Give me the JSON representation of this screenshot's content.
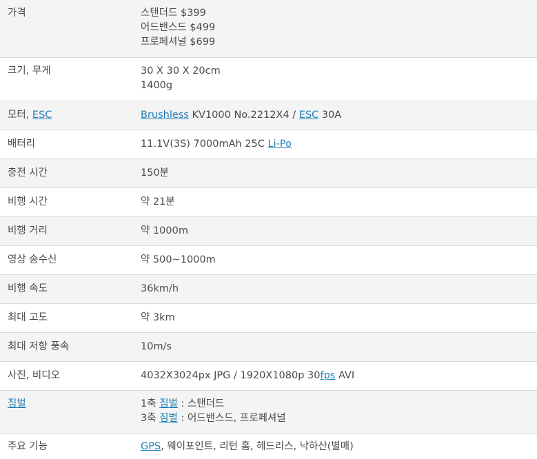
{
  "rows": [
    {
      "label": [
        {
          "t": "가격"
        }
      ],
      "lines": [
        [
          {
            "t": "스탠더드 $399"
          }
        ],
        [
          {
            "t": "어드밴스드 $499"
          }
        ],
        [
          {
            "t": "프로페셔널 $699"
          }
        ]
      ]
    },
    {
      "label": [
        {
          "t": "크기, 무게"
        }
      ],
      "lines": [
        [
          {
            "t": "30 X 30 X 20cm"
          }
        ],
        [
          {
            "t": "1400g"
          }
        ]
      ]
    },
    {
      "label": [
        {
          "t": "모터, "
        },
        {
          "t": "ESC",
          "link": true
        }
      ],
      "lines": [
        [
          {
            "t": "Brushless",
            "link": true
          },
          {
            "t": " KV1000 No.2212X4 / "
          },
          {
            "t": "ESC",
            "link": true
          },
          {
            "t": " 30A"
          }
        ]
      ]
    },
    {
      "label": [
        {
          "t": "배터리"
        }
      ],
      "lines": [
        [
          {
            "t": "11.1V(3S) 7000mAh 25C "
          },
          {
            "t": "Li-Po",
            "link": true
          }
        ]
      ]
    },
    {
      "label": [
        {
          "t": "충전 시간"
        }
      ],
      "lines": [
        [
          {
            "t": "150분"
          }
        ]
      ]
    },
    {
      "label": [
        {
          "t": "비행 시간"
        }
      ],
      "lines": [
        [
          {
            "t": "약 21분"
          }
        ]
      ]
    },
    {
      "label": [
        {
          "t": "비행 거리"
        }
      ],
      "lines": [
        [
          {
            "t": "약 1000m"
          }
        ]
      ]
    },
    {
      "label": [
        {
          "t": "영상 송수신"
        }
      ],
      "lines": [
        [
          {
            "t": "약 500~1000m"
          }
        ]
      ]
    },
    {
      "label": [
        {
          "t": "비행 속도"
        }
      ],
      "lines": [
        [
          {
            "t": "36km/h"
          }
        ]
      ]
    },
    {
      "label": [
        {
          "t": "최대 고도"
        }
      ],
      "lines": [
        [
          {
            "t": "약 3km"
          }
        ]
      ]
    },
    {
      "label": [
        {
          "t": "최대 저항 풍속"
        }
      ],
      "lines": [
        [
          {
            "t": "10m/s"
          }
        ]
      ]
    },
    {
      "label": [
        {
          "t": "사진, 비디오"
        }
      ],
      "lines": [
        [
          {
            "t": "4032X3024px JPG / 1920X1080p 30"
          },
          {
            "t": "fps",
            "link": true
          },
          {
            "t": " AVI"
          }
        ]
      ]
    },
    {
      "label": [
        {
          "t": "짐벌",
          "link": true
        }
      ],
      "lines": [
        [
          {
            "t": "1축 "
          },
          {
            "t": "짐벌",
            "link": true
          },
          {
            "t": " : 스탠더드"
          }
        ],
        [
          {
            "t": "3축 "
          },
          {
            "t": "짐벌",
            "link": true
          },
          {
            "t": " : 어드밴스드, 프로페셔널"
          }
        ]
      ]
    },
    {
      "label": [
        {
          "t": "주요 기능"
        }
      ],
      "lines": [
        [
          {
            "t": "GPS",
            "link": true
          },
          {
            "t": ", 웨이포인트, 리턴 홈, 헤드리스, 낙하산(별매)"
          }
        ]
      ]
    }
  ]
}
